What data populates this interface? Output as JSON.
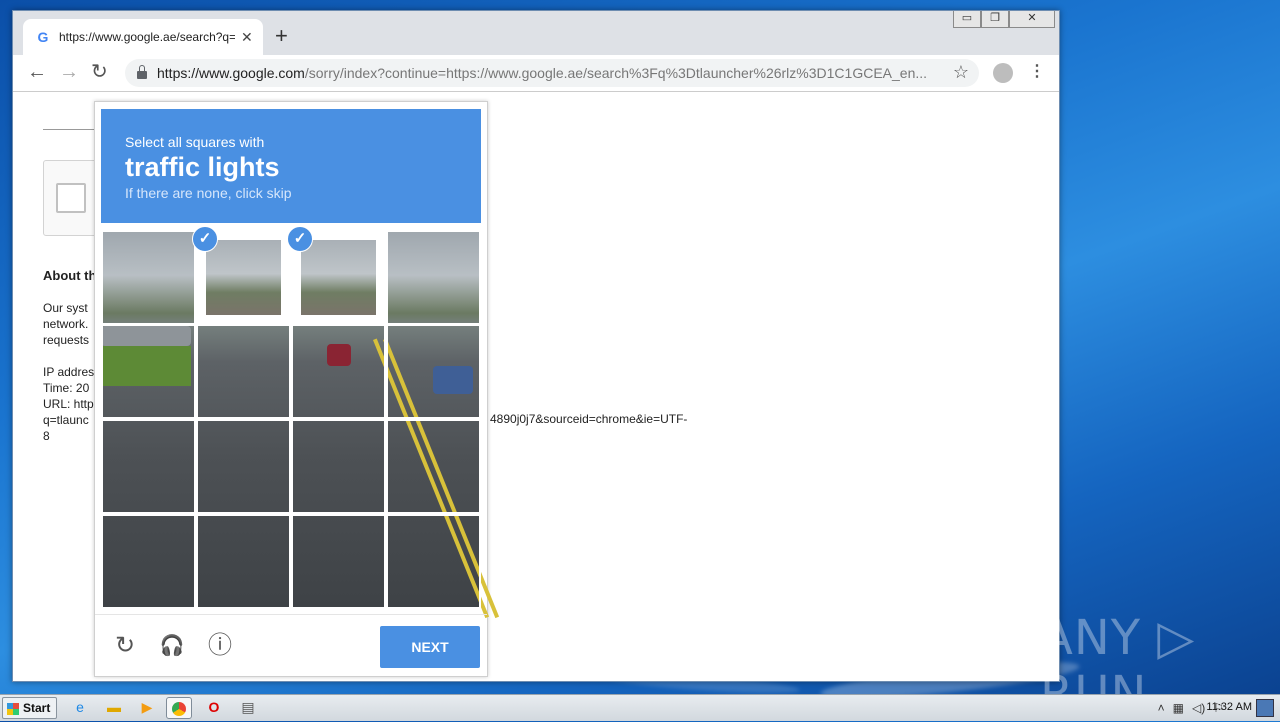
{
  "browser": {
    "tab_title": "https://www.google.ae/search?q=tl",
    "tab_favicon": "G",
    "url_host": "https://www.google.com",
    "url_path": "/sorry/index?continue=https://www.google.ae/search%3Fq%3Dtlauncher%26rlz%3D1C1GCEA_en...",
    "window_buttons": {
      "minimize": "▭",
      "restore": "❐",
      "close": "✕"
    }
  },
  "page": {
    "about_heading": "About th",
    "para1": [
      "Our syst",
      "network.",
      "requests"
    ],
    "para2": [
      "IP addres",
      "Time: 20",
      "URL: http",
      "q=tlaunc",
      "8"
    ],
    "url_fragment": "4890j0j7&sourceid=chrome&ie=UTF-"
  },
  "captcha": {
    "instruction": "Select all squares with",
    "target": "traffic lights",
    "hint": "If there are none, click skip",
    "next_label": "NEXT",
    "selected_tiles": [
      1,
      2
    ]
  },
  "watermark": "ANY ▷ RUN",
  "taskbar": {
    "start_label": "Start",
    "clock": "11:32 AM"
  },
  "colors": {
    "captcha_blue": "#4a90e2",
    "desktop_blue": "#1a74cf"
  }
}
